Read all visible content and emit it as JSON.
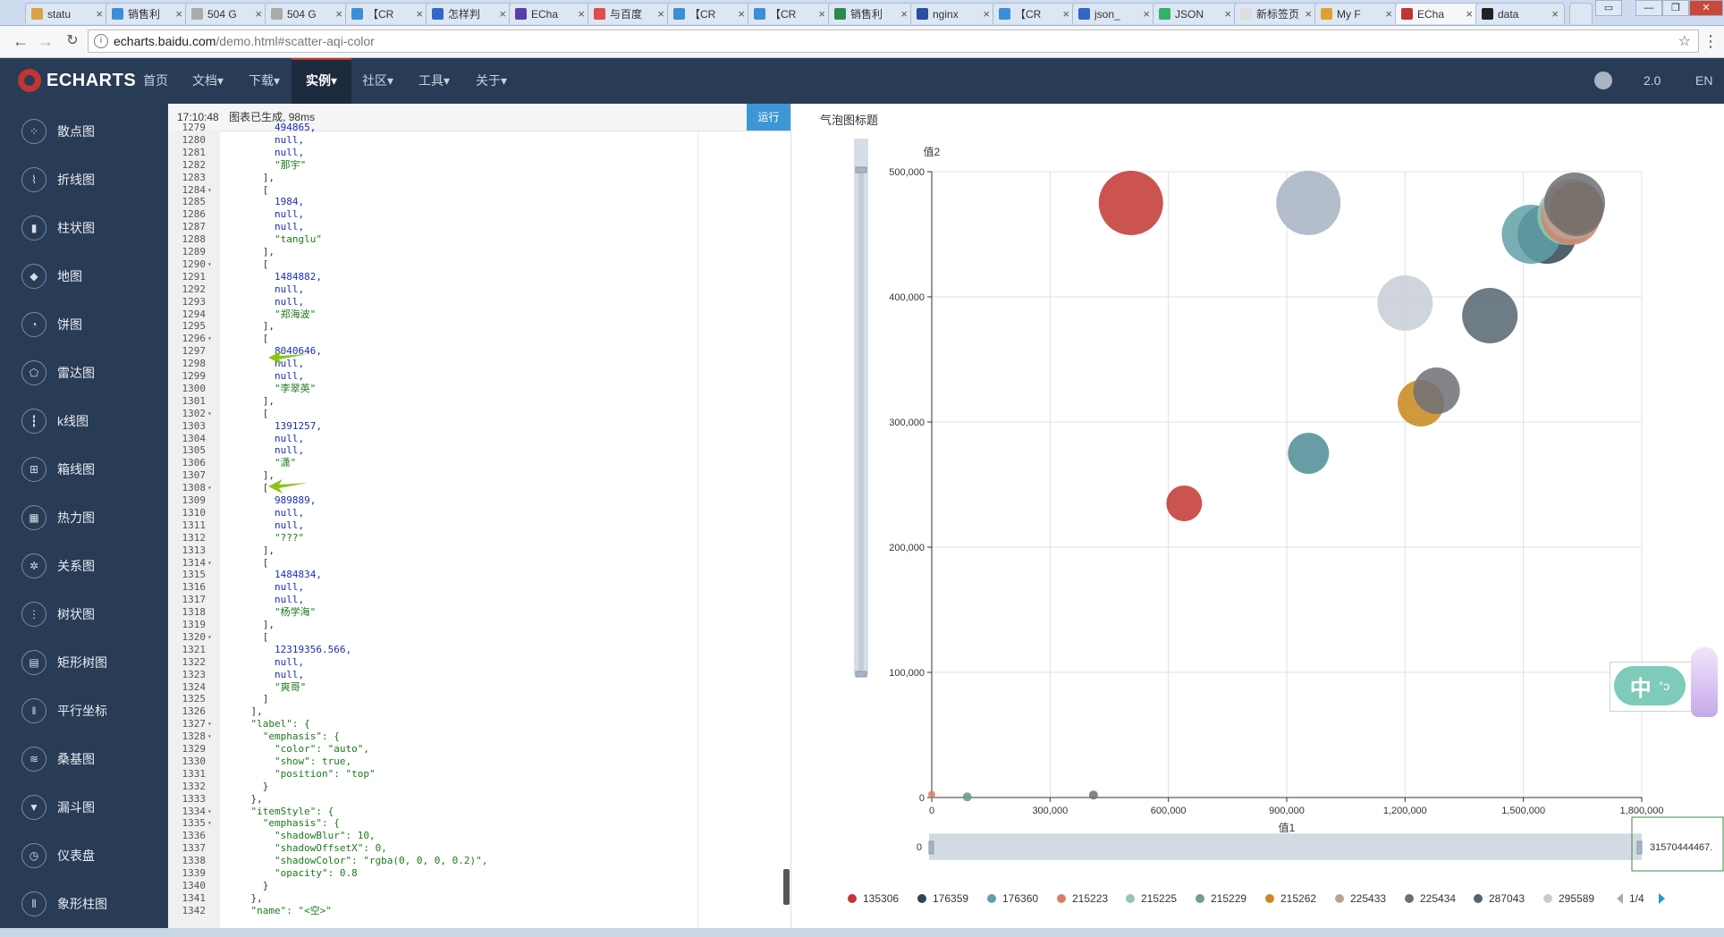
{
  "browser": {
    "tabs": [
      {
        "label": "statu",
        "color": "#d9a441"
      },
      {
        "label": "销售利",
        "color": "#3b8fd9"
      },
      {
        "label": "504 G",
        "color": "#aaaaaa"
      },
      {
        "label": "504 G",
        "color": "#aaaaaa"
      },
      {
        "label": "【CR",
        "color": "#3b8fd9"
      },
      {
        "label": "怎样判",
        "color": "#3067c8"
      },
      {
        "label": "ECha",
        "color": "#5a3ea8"
      },
      {
        "label": "与百度",
        "color": "#e04b4b"
      },
      {
        "label": "【CR",
        "color": "#3b8fd9"
      },
      {
        "label": "【CR",
        "color": "#3b8fd9"
      },
      {
        "label": "销售利",
        "color": "#2b8a4a"
      },
      {
        "label": "nginx",
        "color": "#2a4fa0"
      },
      {
        "label": "【CR",
        "color": "#3b8fd9"
      },
      {
        "label": "json_",
        "color": "#3067c8"
      },
      {
        "label": "JSON",
        "color": "#33b06a"
      },
      {
        "label": "新标签页",
        "color": "#dddddd"
      },
      {
        "label": "My F",
        "color": "#e0a030"
      },
      {
        "label": "ECha",
        "color": "#c23531"
      },
      {
        "label": "data",
        "color": "#222222"
      }
    ],
    "url_domain": "echarts.baidu.com",
    "url_path": "/demo.html#scatter-aqi-color"
  },
  "header": {
    "logo_text": "ECHARTS",
    "nav": [
      "首页",
      "文档▾",
      "下载▾",
      "实例▾",
      "社区▾",
      "工具▾",
      "关于▾"
    ],
    "active_nav": "实例▾",
    "version": "2.0",
    "lang": "EN"
  },
  "sidebar": {
    "items": [
      {
        "label": "散点图",
        "icon": "scatter-icon",
        "glyph": "⁘"
      },
      {
        "label": "折线图",
        "icon": "line-icon",
        "glyph": "⌇"
      },
      {
        "label": "柱状图",
        "icon": "bar-icon",
        "glyph": "▮"
      },
      {
        "label": "地图",
        "icon": "map-icon",
        "glyph": "◆"
      },
      {
        "label": "饼图",
        "icon": "pie-icon",
        "glyph": "◔"
      },
      {
        "label": "雷达图",
        "icon": "radar-icon",
        "glyph": "⬠"
      },
      {
        "label": "k线图",
        "icon": "candlestick-icon",
        "glyph": "┇"
      },
      {
        "label": "箱线图",
        "icon": "boxplot-icon",
        "glyph": "⊞"
      },
      {
        "label": "热力图",
        "icon": "heatmap-icon",
        "glyph": "▦"
      },
      {
        "label": "关系图",
        "icon": "graph-icon",
        "glyph": "✲"
      },
      {
        "label": "树状图",
        "icon": "tree-icon",
        "glyph": "⋮"
      },
      {
        "label": "矩形树图",
        "icon": "treemap-icon",
        "glyph": "▤"
      },
      {
        "label": "平行坐标",
        "icon": "parallel-icon",
        "glyph": "‖"
      },
      {
        "label": "桑基图",
        "icon": "sankey-icon",
        "glyph": "≋"
      },
      {
        "label": "漏斗图",
        "icon": "funnel-icon",
        "glyph": "▼"
      },
      {
        "label": "仪表盘",
        "icon": "gauge-icon",
        "glyph": "◷"
      },
      {
        "label": "象形柱图",
        "icon": "pictorial-bar-icon",
        "glyph": "⫴"
      }
    ]
  },
  "editor": {
    "status_time": "17:10:48",
    "status_text": "图表已生成, 98ms",
    "run_label": "运行",
    "lines": [
      {
        "n": "1279",
        "f": "",
        "t": "        494865,"
      },
      {
        "n": "1280",
        "f": "",
        "t": "        null,"
      },
      {
        "n": "1281",
        "f": "",
        "t": "        null,"
      },
      {
        "n": "1282",
        "f": "",
        "t": "        \"那宇\""
      },
      {
        "n": "1283",
        "f": "",
        "t": "      ],"
      },
      {
        "n": "1284",
        "f": "▾",
        "t": "      ["
      },
      {
        "n": "1285",
        "f": "",
        "t": "        1984,"
      },
      {
        "n": "1286",
        "f": "",
        "t": "        null,"
      },
      {
        "n": "1287",
        "f": "",
        "t": "        null,"
      },
      {
        "n": "1288",
        "f": "",
        "t": "        \"tanglu\""
      },
      {
        "n": "1289",
        "f": "",
        "t": "      ],"
      },
      {
        "n": "1290",
        "f": "▾",
        "t": "      ["
      },
      {
        "n": "1291",
        "f": "",
        "t": "        1484882,"
      },
      {
        "n": "1292",
        "f": "",
        "t": "        null,"
      },
      {
        "n": "1293",
        "f": "",
        "t": "        null,"
      },
      {
        "n": "1294",
        "f": "",
        "t": "        \"郑海波\""
      },
      {
        "n": "1295",
        "f": "",
        "t": "      ],"
      },
      {
        "n": "1296",
        "f": "▾",
        "t": "      ["
      },
      {
        "n": "1297",
        "f": "",
        "t": "        8040646,"
      },
      {
        "n": "1298",
        "f": "",
        "t": "        null,"
      },
      {
        "n": "1299",
        "f": "",
        "t": "        null,"
      },
      {
        "n": "1300",
        "f": "",
        "t": "        \"李翠英\""
      },
      {
        "n": "1301",
        "f": "",
        "t": "      ],"
      },
      {
        "n": "1302",
        "f": "▾",
        "t": "      ["
      },
      {
        "n": "1303",
        "f": "",
        "t": "        1391257,"
      },
      {
        "n": "1304",
        "f": "",
        "t": "        null,"
      },
      {
        "n": "1305",
        "f": "",
        "t": "        null,"
      },
      {
        "n": "1306",
        "f": "",
        "t": "        \"潇\""
      },
      {
        "n": "1307",
        "f": "",
        "t": "      ],"
      },
      {
        "n": "1308",
        "f": "▾",
        "t": "      ["
      },
      {
        "n": "1309",
        "f": "",
        "t": "        989889,"
      },
      {
        "n": "1310",
        "f": "",
        "t": "        null,"
      },
      {
        "n": "1311",
        "f": "",
        "t": "        null,"
      },
      {
        "n": "1312",
        "f": "",
        "t": "        \"???\""
      },
      {
        "n": "1313",
        "f": "",
        "t": "      ],"
      },
      {
        "n": "1314",
        "f": "▾",
        "t": "      ["
      },
      {
        "n": "1315",
        "f": "",
        "t": "        1484834,"
      },
      {
        "n": "1316",
        "f": "",
        "t": "        null,"
      },
      {
        "n": "1317",
        "f": "",
        "t": "        null,"
      },
      {
        "n": "1318",
        "f": "",
        "t": "        \"杨学海\""
      },
      {
        "n": "1319",
        "f": "",
        "t": "      ],"
      },
      {
        "n": "1320",
        "f": "▾",
        "t": "      ["
      },
      {
        "n": "1321",
        "f": "",
        "t": "        12319356.566,"
      },
      {
        "n": "1322",
        "f": "",
        "t": "        null,"
      },
      {
        "n": "1323",
        "f": "",
        "t": "        null,"
      },
      {
        "n": "1324",
        "f": "",
        "t": "        \"爽哥\""
      },
      {
        "n": "1325",
        "f": "",
        "t": "      ]"
      },
      {
        "n": "1326",
        "f": "",
        "t": "    ],"
      },
      {
        "n": "1327",
        "f": "▾",
        "t": "    \"label\": {"
      },
      {
        "n": "1328",
        "f": "▾",
        "t": "      \"emphasis\": {"
      },
      {
        "n": "1329",
        "f": "",
        "t": "        \"color\": \"auto\","
      },
      {
        "n": "1330",
        "f": "",
        "t": "        \"show\": true,"
      },
      {
        "n": "1331",
        "f": "",
        "t": "        \"position\": \"top\""
      },
      {
        "n": "1332",
        "f": "",
        "t": "      }"
      },
      {
        "n": "1333",
        "f": "",
        "t": "    },"
      },
      {
        "n": "1334",
        "f": "▾",
        "t": "    \"itemStyle\": {"
      },
      {
        "n": "1335",
        "f": "▾",
        "t": "      \"emphasis\": {"
      },
      {
        "n": "1336",
        "f": "",
        "t": "        \"shadowBlur\": 10,"
      },
      {
        "n": "1337",
        "f": "",
        "t": "        \"shadowOffsetX\": 0,"
      },
      {
        "n": "1338",
        "f": "",
        "t": "        \"shadowColor\": \"rgba(0, 0, 0, 0.2)\","
      },
      {
        "n": "1339",
        "f": "",
        "t": "        \"opacity\": 0.8"
      },
      {
        "n": "1340",
        "f": "",
        "t": "      }"
      },
      {
        "n": "1341",
        "f": "",
        "t": "    },"
      },
      {
        "n": "1342",
        "f": "",
        "t": "    \"name\": \"<空>\""
      }
    ],
    "arrow_color": "#8cc21a"
  },
  "float_widget": {
    "label": "中",
    "sub": "°ↄ"
  },
  "chart_data": {
    "type": "scatter",
    "title": "气泡图标题",
    "xlabel": "值1",
    "ylabel": "值2",
    "xlim": [
      0,
      1800000
    ],
    "ylim": [
      0,
      500000
    ],
    "xticks": [
      "0",
      "300,000",
      "600,000",
      "900,000",
      "1,200,000",
      "1,500,000",
      "1,800,000"
    ],
    "yticks": [
      "0",
      "100,000",
      "200,000",
      "300,000",
      "400,000",
      "500,000"
    ],
    "grid": true,
    "points": [
      {
        "x": 505000,
        "y": 475000,
        "r": 36,
        "color": "#c23531"
      },
      {
        "x": 955000,
        "y": 475000,
        "r": 36,
        "color": "#a6b2c2"
      },
      {
        "x": 640000,
        "y": 235000,
        "r": 20,
        "color": "#c23531"
      },
      {
        "x": 955000,
        "y": 275000,
        "r": 23,
        "color": "#4f8c96"
      },
      {
        "x": 1200000,
        "y": 395000,
        "r": 31,
        "color": "#c8ced7"
      },
      {
        "x": 1415000,
        "y": 385000,
        "r": 31,
        "color": "#546570"
      },
      {
        "x": 1240000,
        "y": 315000,
        "r": 26,
        "color": "#c7871a"
      },
      {
        "x": 1280000,
        "y": 325000,
        "r": 26,
        "color": "#6e7074"
      },
      {
        "x": 1560000,
        "y": 450000,
        "r": 33,
        "color": "#2f4554"
      },
      {
        "x": 1520000,
        "y": 450000,
        "r": 33,
        "color": "#61a0a8"
      },
      {
        "x": 1610000,
        "y": 465000,
        "r": 33,
        "color": "#91c7ae"
      },
      {
        "x": 1620000,
        "y": 465000,
        "r": 33,
        "color": "#d48265"
      },
      {
        "x": 1625000,
        "y": 470000,
        "r": 34,
        "color": "#bda29a"
      },
      {
        "x": 1630000,
        "y": 475000,
        "r": 34,
        "color": "#6e7074"
      },
      {
        "x": 1635000,
        "y": 470000,
        "r": 30,
        "color": "#7a6f6a"
      },
      {
        "x": 410000,
        "y": 2000,
        "r": 5,
        "color": "#6e7074"
      },
      {
        "x": 90000,
        "y": 500,
        "r": 5,
        "color": "#5e9e7a"
      },
      {
        "x": 0,
        "y": 2500,
        "r": 4,
        "color": "#d48265"
      }
    ],
    "legend": [
      {
        "name": "135306",
        "color": "#c23531"
      },
      {
        "name": "176359",
        "color": "#2f4554"
      },
      {
        "name": "176360",
        "color": "#61a0a8"
      },
      {
        "name": "215223",
        "color": "#d48265"
      },
      {
        "name": "215225",
        "color": "#91c7ae"
      },
      {
        "name": "215229",
        "color": "#749f83"
      },
      {
        "name": "215262",
        "color": "#ca8622"
      },
      {
        "name": "225433",
        "color": "#bda29a"
      },
      {
        "name": "225434",
        "color": "#6e7074"
      },
      {
        "name": "287043",
        "color": "#546570"
      },
      {
        "name": "295589",
        "color": "#c4ccd3"
      }
    ],
    "legend_page": "1/4",
    "datazoom_start": "0",
    "datazoom_end": "31570444467."
  }
}
